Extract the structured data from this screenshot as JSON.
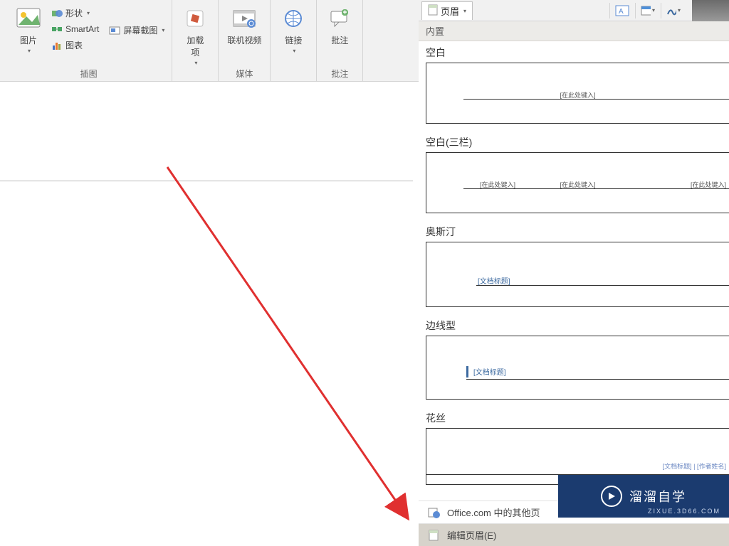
{
  "ribbon": {
    "groups": {
      "illustration": {
        "label": "插图",
        "picture": "图片",
        "shapes": "形状",
        "smartart": "SmartArt",
        "chart": "图表",
        "screenshot": "屏幕截图"
      },
      "addins": {
        "label": "",
        "btn": "加载\n项"
      },
      "media": {
        "label": "媒体",
        "video": "联机视频"
      },
      "links": {
        "label": "",
        "btn": "链接"
      },
      "comments": {
        "label": "批注",
        "btn": "批注"
      }
    }
  },
  "header_dropdown": {
    "toggle_label": "页眉",
    "builtin_header": "内置",
    "templates": {
      "blank": {
        "name": "空白",
        "ph": "[在此处键入]"
      },
      "blank3": {
        "name": "空白(三栏)",
        "ph1": "[在此处键入]",
        "ph2": "[在此处键入]",
        "ph3": "[在此处键入]"
      },
      "austin": {
        "name": "奥斯汀",
        "title": "[文档标题]"
      },
      "border": {
        "name": "边线型",
        "title": "[文档标题]"
      },
      "flower": {
        "name": "花丝",
        "title": "[文档标题] | [作者姓名]"
      }
    },
    "more_online": "Office.com 中的其他页",
    "edit_header": "编辑页眉(E)"
  },
  "watermark": {
    "text": "溜溜自学",
    "url": "ZIXUE.3D66.COM"
  }
}
